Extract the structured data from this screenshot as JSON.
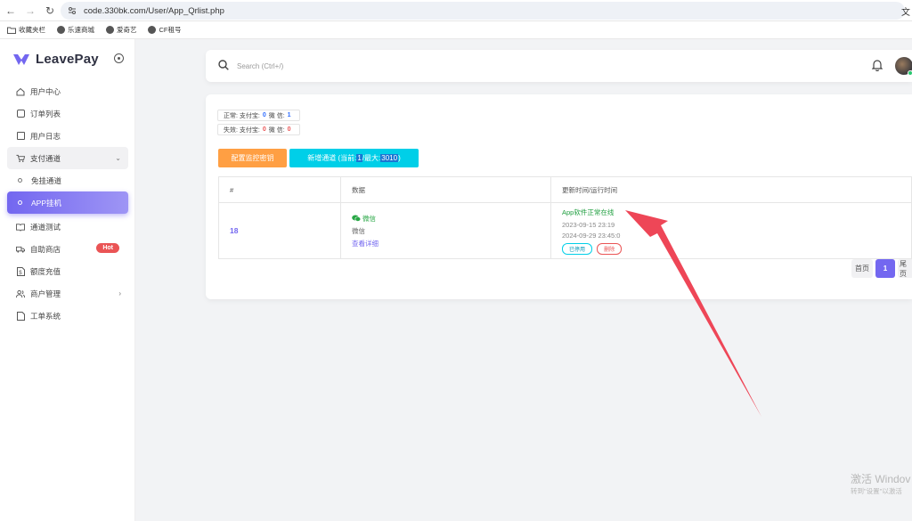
{
  "browser": {
    "url": "code.330bk.com/User/App_Qrlist.php",
    "bookmarks": [
      "收藏夹栏",
      "乐速商城",
      "爱奇艺",
      "CF租号"
    ]
  },
  "sidebar": {
    "brand": "LeavePay",
    "items": [
      {
        "label": "用户中心",
        "icon": "home-icon"
      },
      {
        "label": "订单列表",
        "icon": "book-icon"
      },
      {
        "label": "用户日志",
        "icon": "log-icon"
      },
      {
        "label": "支付通道",
        "icon": "cart-icon"
      },
      {
        "label": "免挂通道",
        "icon": "circle-icon"
      },
      {
        "label": "APP挂机",
        "icon": "circle-icon"
      },
      {
        "label": "通道测试",
        "icon": "book-open-icon"
      },
      {
        "label": "自助商店",
        "icon": "truck-icon"
      },
      {
        "label": "额度充值",
        "icon": "file-dollar-icon"
      },
      {
        "label": "商户管理",
        "icon": "users-icon"
      },
      {
        "label": "工单系统",
        "icon": "file-icon"
      }
    ],
    "hot_badge": "Hot",
    "accent": "#7367f0"
  },
  "header": {
    "search_placeholder": "Search (Ctrl+/)"
  },
  "stats": {
    "normal_prefix": "正常: 支付宝:",
    "normal_alipay": "0",
    "normal_wechat_label": "微 信:",
    "normal_wechat": "1",
    "failed_prefix": "失效: 支付宝:",
    "failed_alipay": "0",
    "failed_wechat_label": "微 信:",
    "failed_wechat": "0"
  },
  "buttons": {
    "config_key": "配置监控密钥",
    "add_channel_prefix": "新增通道 (当前:",
    "add_channel_current": "1",
    "add_channel_mid": "/最大:",
    "add_channel_max": "3010",
    "add_channel_suffix": ")"
  },
  "table": {
    "headers": [
      "#",
      "数据",
      "更新时间/运行时间"
    ],
    "rows": [
      {
        "id": "18",
        "channel_name": "微信",
        "channel_type": "微信",
        "detail_link": "查看详细",
        "status": "App软件正常在线",
        "updated": "2023-09-15 23:19",
        "runtime": "2024-09-29 23:45:0",
        "tag_enabled": "已停用",
        "tag_delete": "删除"
      }
    ]
  },
  "pagination": {
    "first": "首页",
    "current": "1",
    "last": "尾页"
  },
  "watermark": {
    "line1": "激活 Windov",
    "line2": "转到\"设置\"以激活"
  }
}
